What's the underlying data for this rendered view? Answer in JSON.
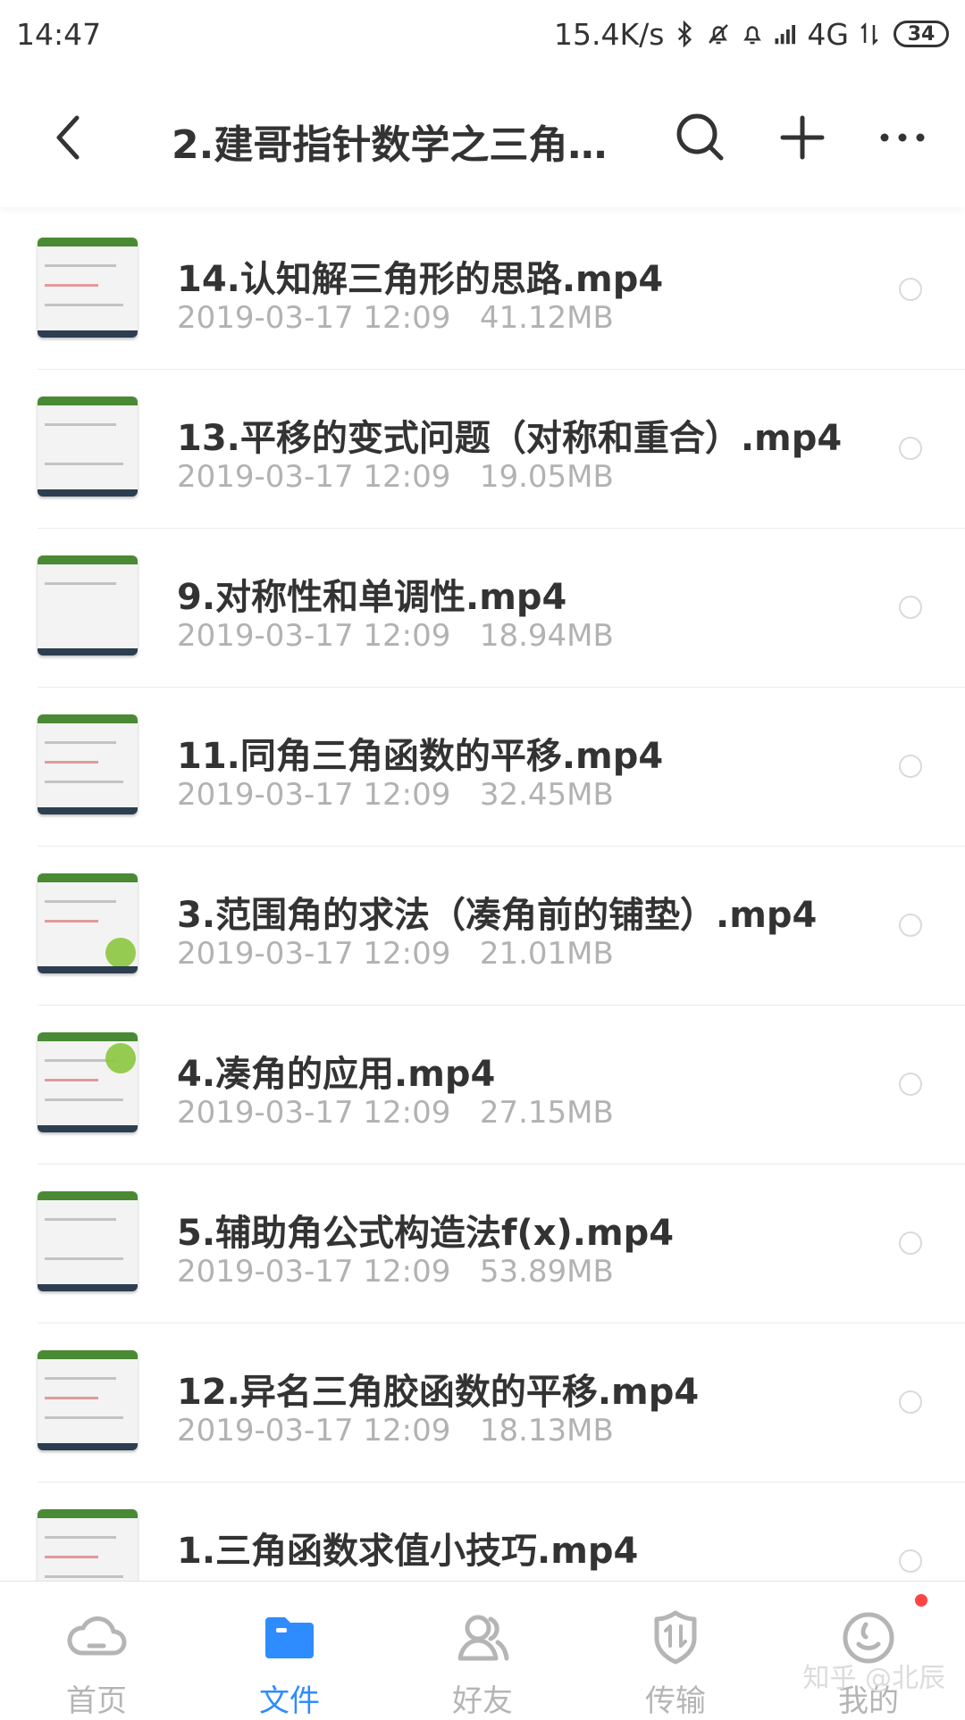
{
  "status_bar": {
    "time": "14:47",
    "network_speed": "15.4K/s",
    "network_type": "4G",
    "battery": "34"
  },
  "header": {
    "title": "2.建哥指针数学之三角…",
    "icons": [
      "back-icon",
      "search-icon",
      "plus-icon",
      "more-icon"
    ]
  },
  "files": [
    {
      "name": "14.认知解三角形的思路.mp4",
      "date": "2019-03-17  12:09",
      "size": "41.12MB"
    },
    {
      "name": "13.平移的变式问题（对称和重合）.mp4",
      "date": "2019-03-17  12:09",
      "size": "19.05MB"
    },
    {
      "name": "9.对称性和单调性.mp4",
      "date": "2019-03-17  12:09",
      "size": "18.94MB"
    },
    {
      "name": "11.同角三角函数的平移.mp4",
      "date": "2019-03-17  12:09",
      "size": "32.45MB"
    },
    {
      "name": "3.范围角的求法（凑角前的铺垫）.mp4",
      "date": "2019-03-17  12:09",
      "size": "21.01MB"
    },
    {
      "name": "4.凑角的应用.mp4",
      "date": "2019-03-17  12:09",
      "size": "27.15MB"
    },
    {
      "name": "5.辅助角公式构造法f(x).mp4",
      "date": "2019-03-17  12:09",
      "size": "53.89MB"
    },
    {
      "name": "12.异名三角胶函数的平移.mp4",
      "date": "2019-03-17  12:09",
      "size": "18.13MB"
    },
    {
      "name": "1.三角函数求值小技巧.mp4",
      "date": "",
      "size": ""
    }
  ],
  "bottom_nav": [
    {
      "label": "首页",
      "icon": "cloud-home-icon"
    },
    {
      "label": "文件",
      "icon": "folder-icon",
      "active": true
    },
    {
      "label": "好友",
      "icon": "friends-icon"
    },
    {
      "label": "传输",
      "icon": "transfer-shield-icon"
    },
    {
      "label": "我的",
      "icon": "profile-icon"
    }
  ],
  "watermark": "知乎 @北辰",
  "colors": {
    "accent": "#2e8cff",
    "text": "#333333",
    "meta": "#b2b2b2",
    "badge": "#ff4444"
  }
}
